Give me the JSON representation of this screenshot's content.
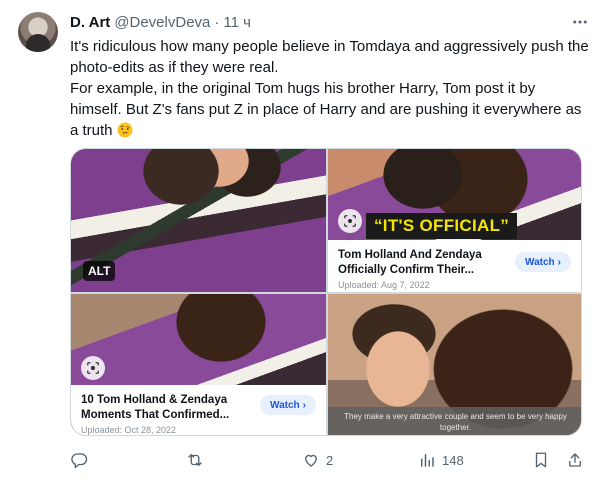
{
  "tweet": {
    "author_name": "D. Art",
    "author_handle": "@DevelvDeva",
    "separator": "·",
    "time": "11 ч",
    "text_line1": "It's ridiculous how many people believe in Tomdaya and aggressively push the photo-edits as if they were real.",
    "text_line2": "For example, in the original Tom hugs his brother Harry, Tom post it by himself. But Z's fans put Z in place of Harry and are pushing it everywhere as a truth",
    "emoji_icon": "face-with-raised-eyebrow-emoji"
  },
  "media": {
    "tile1": {
      "alt_badge": "ALT"
    },
    "tile2": {
      "banner": "“IT'S OFFICIAL”",
      "card_title": "Tom Holland And Zendaya Officially Confirm Their...",
      "card_sub": "Uploaded: Aug 7, 2022",
      "watch_label": "Watch",
      "watch_chevron": "›"
    },
    "tile3": {
      "card_title": "10 Tom Holland & Zendaya Moments That Confirmed...",
      "card_sub": "Uploaded: Oct 28, 2022",
      "watch_label": "Watch",
      "watch_chevron": "›"
    },
    "tile4": {
      "caption": "They make a very attractive couple and seem to be very happy together."
    }
  },
  "actions": {
    "reply_count": "",
    "retweet_count": "",
    "like_count": "2",
    "views_count": "148"
  },
  "colors": {
    "text_primary": "#0f1419",
    "text_secondary": "#536471",
    "border": "#cfd9de",
    "banner_text": "#f5e400",
    "watch_text": "#1a56db"
  }
}
